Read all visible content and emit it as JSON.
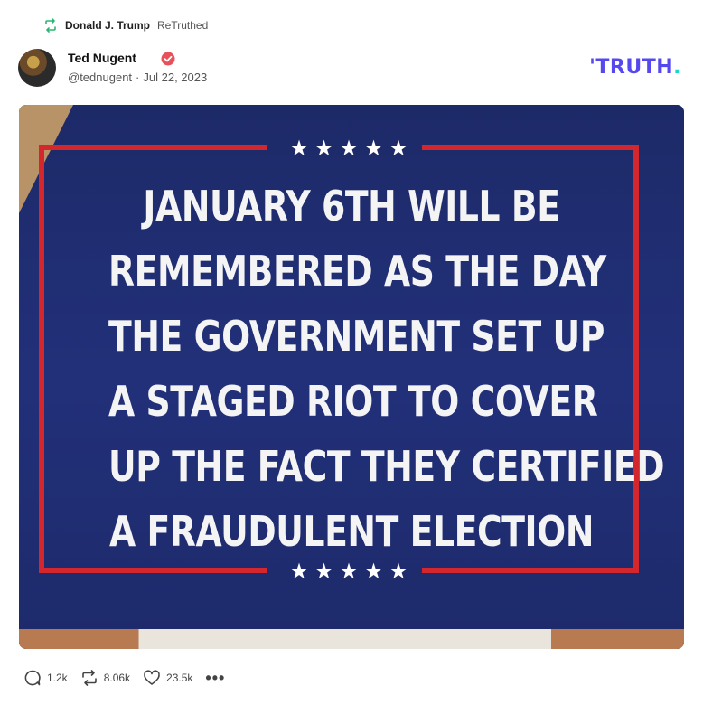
{
  "retruth": {
    "icon": "retruth-icon",
    "user": "Donald J. Trump",
    "label": "ReTruthed",
    "color": "#2bb673"
  },
  "post": {
    "author_name": "Ted Nugent",
    "handle": "@tednugent",
    "separator": "·",
    "date": "Jul 22, 2023",
    "verified_color": "#e8515a"
  },
  "brand": {
    "name": "TRUTH",
    "suffix": ".",
    "color": "#5448ee",
    "accent": "#1ed6c4"
  },
  "media": {
    "stars_top": "★★★★★",
    "stars_bottom": "★★★★★",
    "lines": [
      "JANUARY 6TH WILL BE",
      "REMEMBERED AS THE DAY",
      "THE GOVERNMENT SET UP",
      "A STAGED RIOT TO COVER",
      "UP THE FACT THEY CERTIFIED",
      "A FRAUDULENT ELECTION"
    ],
    "background": "#1f2d6e",
    "frame_color": "#d4262d"
  },
  "actions": {
    "replies": "1.2k",
    "retruths": "8.06k",
    "likes": "23.5k",
    "more": "•••"
  }
}
